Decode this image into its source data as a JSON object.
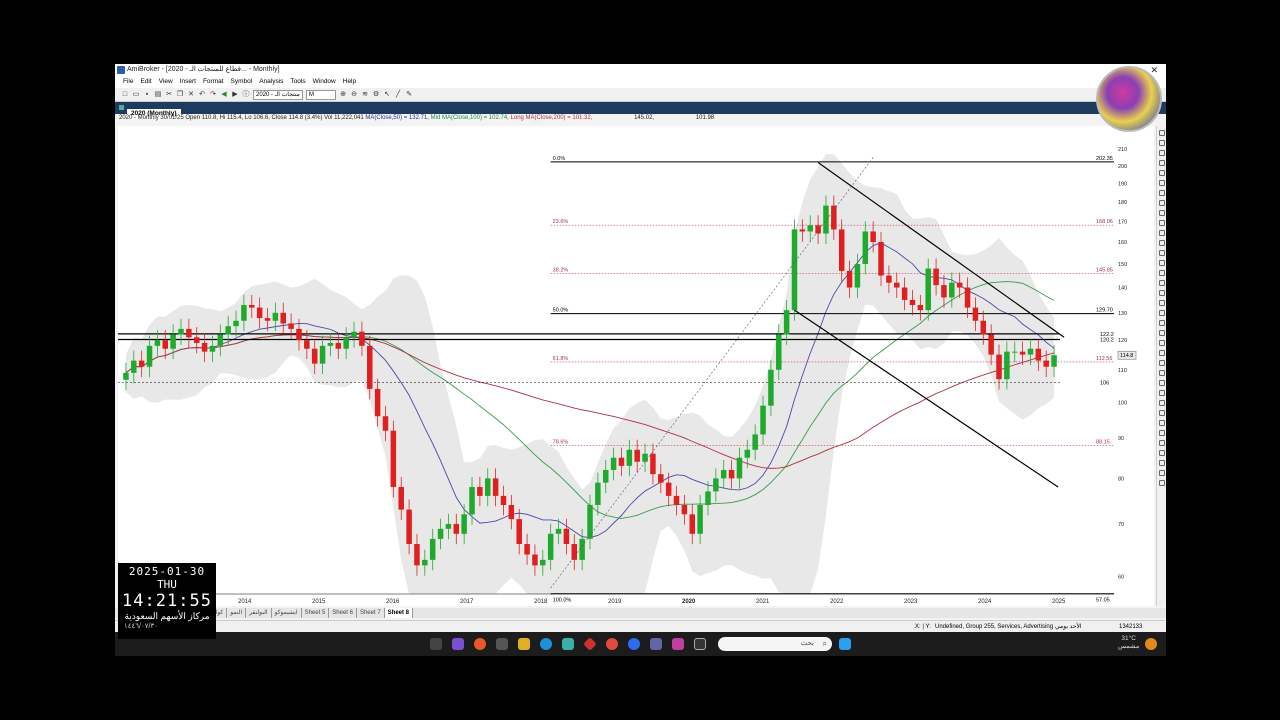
{
  "window": {
    "title": "AmiBroker - [2020 - قطاع للمنتجات الـ... - Monthly]",
    "close": "✕"
  },
  "menu": [
    "File",
    "Edit",
    "View",
    "Insert",
    "Format",
    "Symbol",
    "Analysis",
    "Tools",
    "Window",
    "Help"
  ],
  "toolbar": {
    "symbol_field": "2020 - منتجات الـ",
    "interval_field": "M"
  },
  "chart_tab": {
    "label": "2020 (Monthly)"
  },
  "info_line": {
    "prefix": "2020 - Monthly 30/01/25 Open 110.8, Hi 115.4, Lo 106.6, Close 114.8 (3.4%) Vol 11,222,041",
    "ma_short": "MA(Close,50) = 132.71,",
    "ma_mid": "Mid MA(Close,100) = 102.74,",
    "ma_long": "Long MA(Close,200) = 101.32,",
    "val1": "145.02,",
    "val2": "101.98"
  },
  "chart_data": {
    "type": "candlestick",
    "symbol": "2020",
    "interval": "Monthly",
    "y_axis_scale": "log",
    "ylim": [
      57,
      212
    ],
    "y_ticks": [
      60,
      70,
      80,
      90,
      100,
      110,
      120,
      130,
      140,
      150,
      160,
      170,
      180,
      190,
      200,
      210
    ],
    "x_ticks": [
      "2014",
      "2015",
      "2016",
      "2017",
      "2018",
      "2019",
      "2020",
      "2021",
      "2022",
      "2023",
      "2024",
      "2025"
    ],
    "fib_levels": [
      {
        "label": "0.0%",
        "value": 202.35
      },
      {
        "label": "23.6%",
        "value": 168.06
      },
      {
        "label": "38.2%",
        "value": 145.85
      },
      {
        "label": "50.0%",
        "value": 129.7
      },
      {
        "label": "61.8%",
        "value": 112.56
      },
      {
        "label": "78.6%",
        "value": 88.15
      },
      {
        "label": "100.0%",
        "value": 57.05
      }
    ],
    "fib_value_labels": [
      "202.35",
      "168.06",
      "145.85",
      "129.70",
      "112.56",
      "88.15",
      "57.05"
    ],
    "right_labels": [
      "122.2",
      "120.2",
      "106"
    ],
    "last_price": "114.8",
    "horizontal_lines": [
      122.2,
      120.2,
      106
    ],
    "moving_averages": [
      {
        "name": "MA(Close,50)",
        "color": "#4a4aa8",
        "last": 132.71
      },
      {
        "name": "MA(Close,100)",
        "color": "#3a9a4a",
        "last": 102.74
      },
      {
        "name": "MA(Close,200)",
        "color": "#b03040",
        "last": 101.32
      }
    ],
    "candles_note": "monthly OHLC approximated from screenshot",
    "closes": [
      109,
      113,
      111,
      118,
      120,
      117,
      122,
      124,
      121,
      119,
      116,
      118,
      122,
      125,
      127,
      133,
      132,
      128,
      127,
      130,
      126,
      124,
      120,
      117,
      112,
      118,
      119,
      117,
      121,
      123,
      118,
      104,
      96,
      92,
      78,
      73,
      66,
      62,
      63,
      67,
      69,
      70,
      68,
      72,
      78,
      76,
      80,
      76,
      74,
      71,
      66,
      64,
      62,
      63,
      68,
      69,
      66,
      63,
      67,
      74,
      79,
      82,
      85,
      83,
      87,
      84,
      86,
      81,
      79,
      76,
      74,
      72,
      68,
      74,
      77,
      80,
      82,
      80,
      85,
      87,
      91,
      99,
      110,
      122,
      131,
      166,
      165,
      168,
      164,
      178,
      166,
      147,
      140,
      150,
      165,
      160,
      145,
      142,
      140,
      135,
      133,
      131,
      148,
      141,
      136,
      142,
      140,
      132,
      127,
      122,
      115,
      107,
      116,
      116,
      115,
      117,
      113,
      111,
      114.8
    ]
  },
  "sheets": [
    "كولون",
    "النمو",
    "البولنقر",
    "ايشيموكو",
    "Sheet 5",
    "Sheet 6",
    "Sheet 7",
    "Sheet 8"
  ],
  "active_sheet": "Sheet 8",
  "status": {
    "axis": "X: | Y:",
    "info": "Undefined, Group 255, Services, Advertising",
    "day": "الأحد يومي",
    "count": "1342133"
  },
  "taskbar": {
    "search_placeholder": "بحث",
    "weather_temp": "31°C",
    "weather_desc": "مشمس"
  },
  "overlay": {
    "date": "2025-01-30",
    "weekday": "THU",
    "time": "14:21:55",
    "name": "مركاز الأسهم السعودية",
    "hijri": "١٤٤٦/٠٧/٣٠"
  }
}
